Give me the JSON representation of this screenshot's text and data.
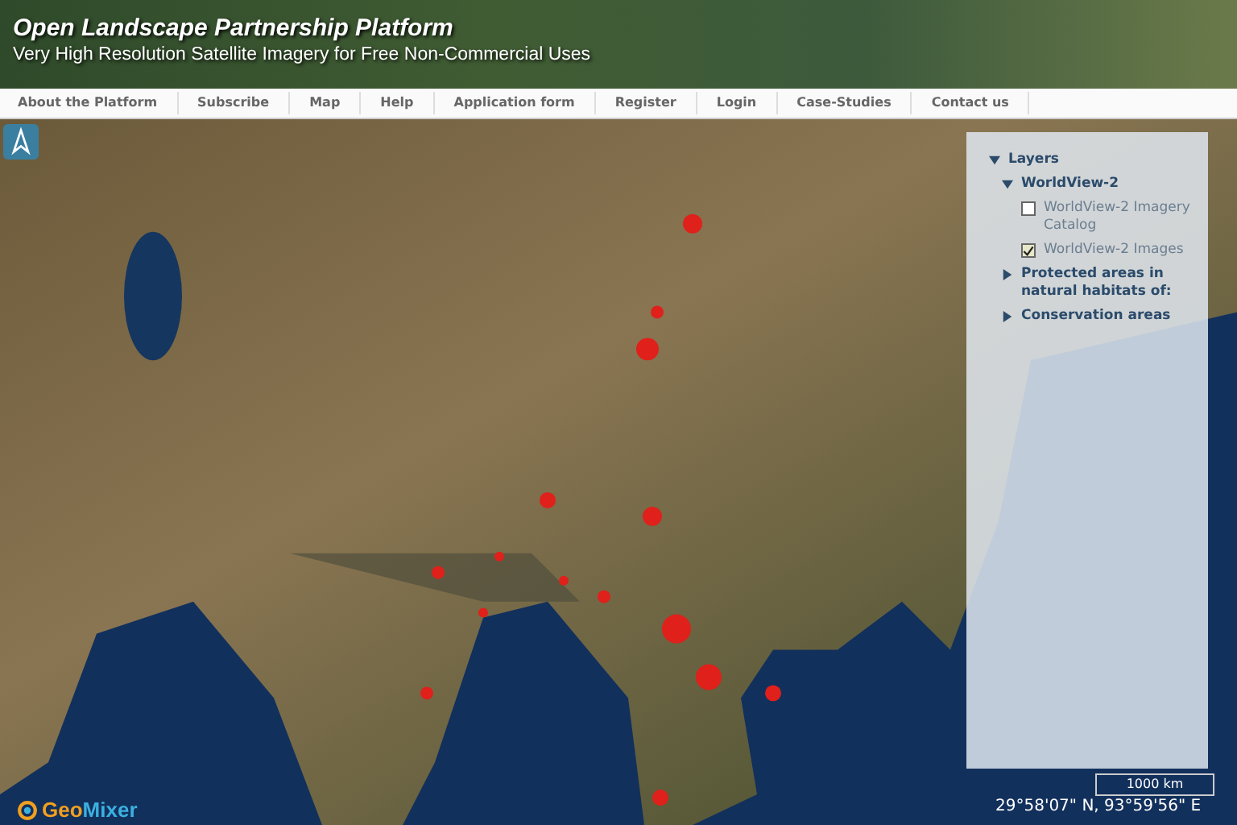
{
  "header": {
    "title": "Open Landscape Partnership Platform",
    "subtitle": "Very High Resolution Satellite Imagery for Free Non-Commercial Uses"
  },
  "nav": [
    {
      "label": "About the Platform"
    },
    {
      "label": "Subscribe"
    },
    {
      "label": "Map"
    },
    {
      "label": "Help"
    },
    {
      "label": "Application form"
    },
    {
      "label": "Register"
    },
    {
      "label": "Login"
    },
    {
      "label": "Case-Studies"
    },
    {
      "label": "Contact us"
    }
  ],
  "layers": {
    "title": "Layers",
    "expanded": true,
    "children": [
      {
        "kind": "group",
        "label": "WorldView-2",
        "expanded": true,
        "children": [
          {
            "kind": "layer",
            "label": "WorldView-2 Imagery Catalog",
            "checked": false
          },
          {
            "kind": "layer",
            "label": "WorldView-2 Images",
            "checked": true
          }
        ]
      },
      {
        "kind": "group",
        "label": "Protected areas in natural habitats of:",
        "expanded": false
      },
      {
        "kind": "group",
        "label": "Conservation areas",
        "expanded": false
      }
    ]
  },
  "scale": "1000 km",
  "coordinates": "29°58'07\" N, 93°59'56\" E",
  "logo": {
    "part_1": "Geo",
    "part_2": "Mixer"
  }
}
